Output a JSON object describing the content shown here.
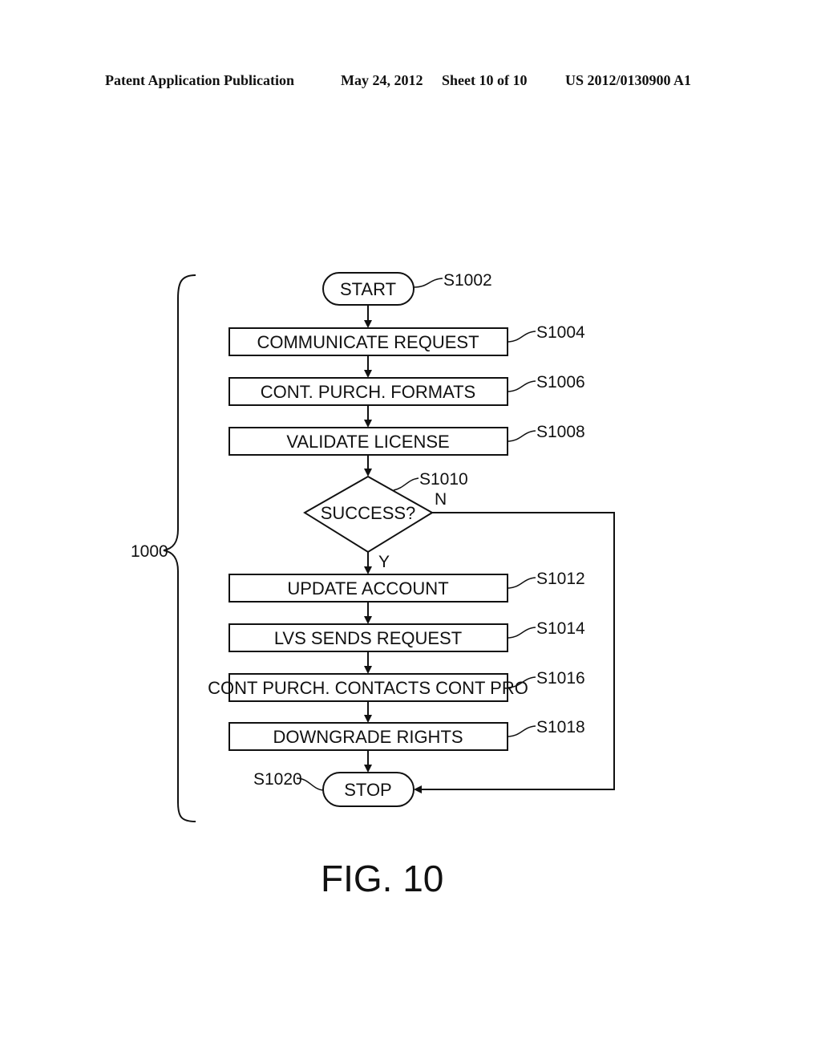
{
  "header": {
    "publication": "Patent Application Publication",
    "date": "May 24, 2012",
    "sheet": "Sheet 10 of 10",
    "number": "US 2012/0130900 A1"
  },
  "diagram": {
    "overall_ref": "1000",
    "start": {
      "label": "START",
      "ref": "S1002"
    },
    "steps_before": [
      {
        "label": "COMMUNICATE REQUEST",
        "ref": "S1004"
      },
      {
        "label": "CONT. PURCH. FORMATS",
        "ref": "S1006"
      },
      {
        "label": "VALIDATE LICENSE",
        "ref": "S1008"
      }
    ],
    "decision": {
      "label": "SUCCESS?",
      "ref": "S1010",
      "yes": "Y",
      "no": "N"
    },
    "steps_after": [
      {
        "label": "UPDATE ACCOUNT",
        "ref": "S1012"
      },
      {
        "label": "LVS SENDS REQUEST",
        "ref": "S1014"
      },
      {
        "label": "CONT PURCH. CONTACTS CONT PRO",
        "ref": "S1016"
      },
      {
        "label": "DOWNGRADE RIGHTS",
        "ref": "S1018"
      }
    ],
    "stop": {
      "label": "STOP",
      "ref": "S1020"
    }
  },
  "figure_label": "FIG. 10"
}
